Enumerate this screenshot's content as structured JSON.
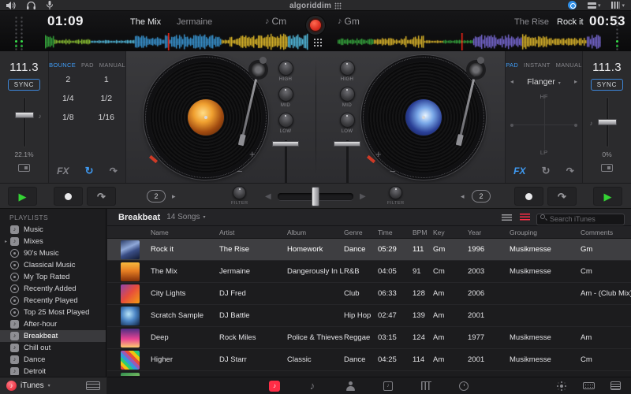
{
  "menubar": {
    "logo": "algoriddim",
    "left_icons": [
      "volume",
      "headphones",
      "microphone"
    ],
    "right_icons": [
      "status-blue",
      "deck-layout",
      "mixer-layout"
    ]
  },
  "deck_a": {
    "time": "01:09",
    "title": "The Mix",
    "artist": "Jermaine",
    "key": "Cm",
    "tempo": "111.3",
    "sync_label": "SYNC",
    "pitch_percent": "22.1%",
    "tabs": [
      "BOUNCE",
      "PAD",
      "MANUAL"
    ],
    "active_tab": "BOUNCE",
    "pads": [
      "2",
      "1",
      "1/4",
      "1/2",
      "1/8",
      "1/16"
    ],
    "fx_label": "FX",
    "loop_beats": "2"
  },
  "deck_b": {
    "time": "00:53",
    "title": "Rock it",
    "artist": "The Rise",
    "key": "Gm",
    "tempo": "111.3",
    "sync_label": "SYNC",
    "pitch_percent": "0%",
    "tabs": [
      "PAD",
      "INSTANT",
      "MANUAL"
    ],
    "active_tab": "PAD",
    "fx_name": "Flanger",
    "pad_top_label": "HF",
    "pad_bottom_label": "LP",
    "fx_label": "FX",
    "loop_beats": "2"
  },
  "mixer": {
    "eq_labels": [
      "HIGH",
      "MID",
      "LOW"
    ],
    "filter_label": "FILTER"
  },
  "sidebar": {
    "header": "PLAYLISTS",
    "items": [
      {
        "label": "Music",
        "icon": "playlist"
      },
      {
        "label": "Mixes",
        "icon": "playlist",
        "expandable": true
      },
      {
        "label": "90's Music",
        "icon": "smart"
      },
      {
        "label": "Classical Music",
        "icon": "smart"
      },
      {
        "label": "My Top Rated",
        "icon": "smart"
      },
      {
        "label": "Recently Added",
        "icon": "smart"
      },
      {
        "label": "Recently Played",
        "icon": "smart"
      },
      {
        "label": "Top 25 Most Played",
        "icon": "smart"
      },
      {
        "label": "After-hour",
        "icon": "playlist"
      },
      {
        "label": "Breakbeat",
        "icon": "playlist",
        "selected": true
      },
      {
        "label": "Chill out",
        "icon": "playlist"
      },
      {
        "label": "Dance",
        "icon": "playlist"
      },
      {
        "label": "Detroit",
        "icon": "playlist"
      }
    ],
    "source_label": "iTunes"
  },
  "library": {
    "playlist_name": "Breakbeat",
    "song_count": "14 Songs",
    "search_placeholder": "Search iTunes",
    "columns": [
      "Name",
      "Artist",
      "Album",
      "Genre",
      "Time",
      "BPM",
      "Key",
      "Year",
      "Grouping",
      "Comments"
    ],
    "rows": [
      {
        "name": "Rock it",
        "artist": "The Rise",
        "album": "Homework",
        "genre": "Dance",
        "time": "05:29",
        "bpm": "111",
        "key": "Gm",
        "year": "1996",
        "grouping": "Musikmesse",
        "comments": "Gm",
        "selected": true,
        "art": "art-rockit"
      },
      {
        "name": "The Mix",
        "artist": "Jermaine",
        "album": "Dangerously In Love",
        "genre": "R&B",
        "time": "04:05",
        "bpm": "91",
        "key": "Cm",
        "year": "2003",
        "grouping": "Musikmesse",
        "comments": "Cm",
        "art": "art-themix"
      },
      {
        "name": "City Lights",
        "artist": "DJ Fred",
        "album": "",
        "genre": "Club",
        "time": "06:33",
        "bpm": "128",
        "key": "Am",
        "year": "2006",
        "grouping": "",
        "comments": "Am - (Club Mix)",
        "art": "art-citylights"
      },
      {
        "name": "Scratch Sample",
        "artist": "DJ Battle",
        "album": "",
        "genre": "Hip Hop",
        "time": "02:47",
        "bpm": "139",
        "key": "Am",
        "year": "2001",
        "grouping": "",
        "comments": "",
        "art": "art-scratch"
      },
      {
        "name": "Deep",
        "artist": "Rock Miles",
        "album": "Police & Thieves",
        "genre": "Reggae",
        "time": "03:15",
        "bpm": "124",
        "key": "Am",
        "year": "1977",
        "grouping": "Musikmesse",
        "comments": "Am",
        "art": "art-deep"
      },
      {
        "name": "Higher",
        "artist": "DJ Starr",
        "album": "Classic",
        "genre": "Dance",
        "time": "04:25",
        "bpm": "114",
        "key": "Am",
        "year": "2001",
        "grouping": "Musikmesse",
        "comments": "Cm",
        "art": "art-higher"
      }
    ]
  },
  "toolbar": {
    "tabs": [
      "library",
      "songs",
      "artists",
      "albums",
      "genres",
      "history"
    ],
    "active": "library",
    "right": [
      "brightness",
      "mini-player",
      "queue"
    ]
  },
  "colors": {
    "accent_blue": "#3f9bf4",
    "accent_red": "#ff2d46",
    "play_green": "#34d334",
    "record_red": "#e03224",
    "waveform_playhead": "#ff2617"
  }
}
